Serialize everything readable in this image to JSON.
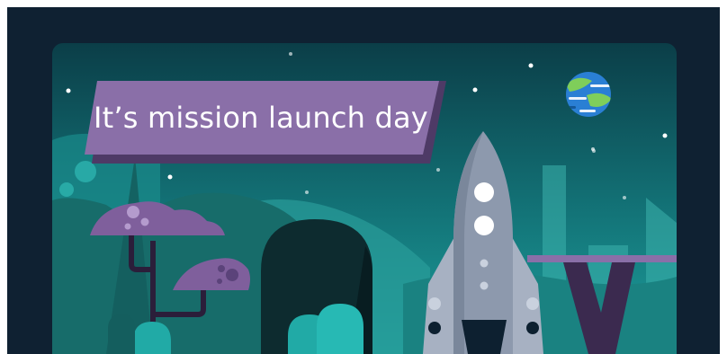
{
  "banner": {
    "title": "It’s mission launch day"
  },
  "colors": {
    "background": "#0f2132",
    "sky_top": "#0b3e48",
    "sky_bottom": "#1d9f9c",
    "banner": "#8a6fa8",
    "banner_shadow": "#4e3a66",
    "rocket": "#8d99ad",
    "planet_ocean": "#2a7fd4",
    "planet_land": "#7fce5a"
  },
  "icons": {
    "planet": "earth-planet-icon",
    "rocket": "rocket-icon"
  }
}
